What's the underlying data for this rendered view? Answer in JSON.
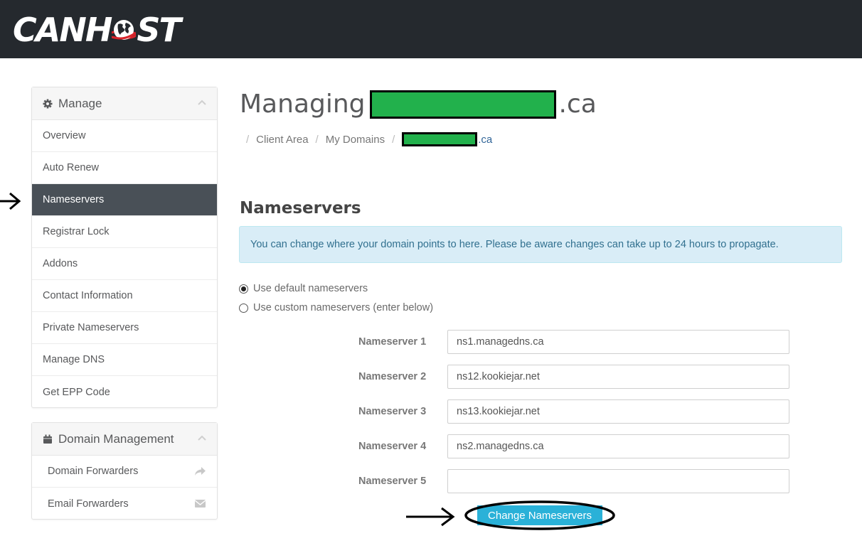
{
  "header": {
    "brand_can": "CAN",
    "brand_h": "H",
    "brand_st": "ST"
  },
  "sidebar": {
    "manage": {
      "title": "Manage",
      "icon": "gear-icon",
      "items": [
        {
          "label": "Overview",
          "active": false
        },
        {
          "label": "Auto Renew",
          "active": false
        },
        {
          "label": "Nameservers",
          "active": true
        },
        {
          "label": "Registrar Lock",
          "active": false
        },
        {
          "label": "Addons",
          "active": false
        },
        {
          "label": "Contact Information",
          "active": false
        },
        {
          "label": "Private Nameservers",
          "active": false
        },
        {
          "label": "Manage DNS",
          "active": false
        },
        {
          "label": "Get EPP Code",
          "active": false
        }
      ]
    },
    "domain_management": {
      "title": "Domain Management",
      "icon": "calendar-icon",
      "items": [
        {
          "label": "Domain Forwarders",
          "icon": "share-arrow-icon"
        },
        {
          "label": "Email Forwarders",
          "icon": "envelope-icon"
        }
      ]
    }
  },
  "main": {
    "title_prefix": "Managing",
    "title_suffix": ".ca",
    "breadcrumb": {
      "items": [
        "Client Area",
        "My Domains"
      ],
      "current_suffix": ".ca",
      "separator": "/"
    },
    "section_title": "Nameservers",
    "info_message": "You can change where your domain points to here. Please be aware changes can take up to 24 hours to propagate.",
    "options": {
      "default_label": "Use default nameservers",
      "custom_label": "Use custom nameservers (enter below)",
      "selected": "default"
    },
    "nameservers": [
      {
        "label": "Nameserver 1",
        "value": "ns1.managedns.ca"
      },
      {
        "label": "Nameserver 2",
        "value": "ns12.kookiejar.net"
      },
      {
        "label": "Nameserver 3",
        "value": "ns13.kookiejar.net"
      },
      {
        "label": "Nameserver 4",
        "value": "ns2.managedns.ca"
      },
      {
        "label": "Nameserver 5",
        "value": ""
      }
    ],
    "submit_label": "Change Nameservers"
  },
  "colors": {
    "header_bg": "#25292e",
    "active_item_bg": "#495057",
    "info_bg": "#d9edf7",
    "button_bg": "#2ab1d8",
    "redaction": "#22b14c"
  }
}
